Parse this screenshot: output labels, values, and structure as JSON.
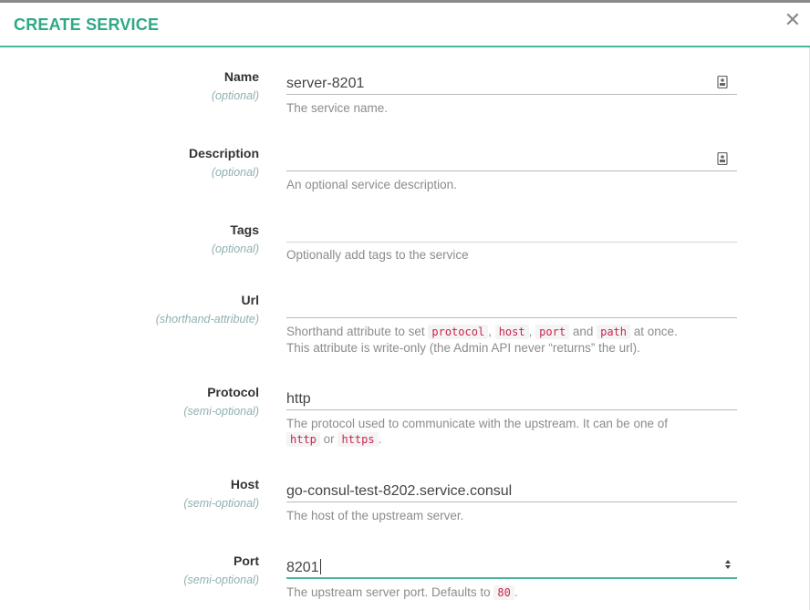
{
  "dialog": {
    "title": "CREATE SERVICE",
    "close_glyph": "✕"
  },
  "fields": {
    "name": {
      "label": "Name",
      "qualifier": "(optional)",
      "value": "server-8201",
      "help": "The service name.",
      "icon": "contact-card-icon"
    },
    "description": {
      "label": "Description",
      "qualifier": "(optional)",
      "value": "",
      "help": "An optional service description.",
      "icon": "contact-card-icon"
    },
    "tags": {
      "label": "Tags",
      "qualifier": "(optional)",
      "value": "",
      "help": "Optionally add tags to the service"
    },
    "url": {
      "label": "Url",
      "qualifier": "(shorthand-attribute)",
      "value": "",
      "help_prefix": "Shorthand attribute to set",
      "code1": "protocol",
      "sep1": ",",
      "code2": "host",
      "sep2": ",",
      "code3": "port",
      "and": "and",
      "code4": "path",
      "suffix": "at once.",
      "help_line2": "This attribute is write-only (the Admin API never “returns” the url)."
    },
    "protocol": {
      "label": "Protocol",
      "qualifier": "(semi-optional)",
      "value": "http",
      "help_prefix": "The protocol used to communicate with the upstream. It can be one of",
      "code1": "http",
      "or": "or",
      "code2": "https",
      "suffix": "."
    },
    "host": {
      "label": "Host",
      "qualifier": "(semi-optional)",
      "value": "go-consul-test-8202.service.consul",
      "help": "The host of the upstream server."
    },
    "port": {
      "label": "Port",
      "qualifier": "(semi-optional)",
      "value": "8201",
      "help_prefix": "The upstream server port. Defaults to",
      "code1": "80",
      "suffix": "."
    }
  },
  "colors": {
    "accent": "#4bb79a",
    "title": "#2ea887",
    "code": "#c7254e"
  }
}
